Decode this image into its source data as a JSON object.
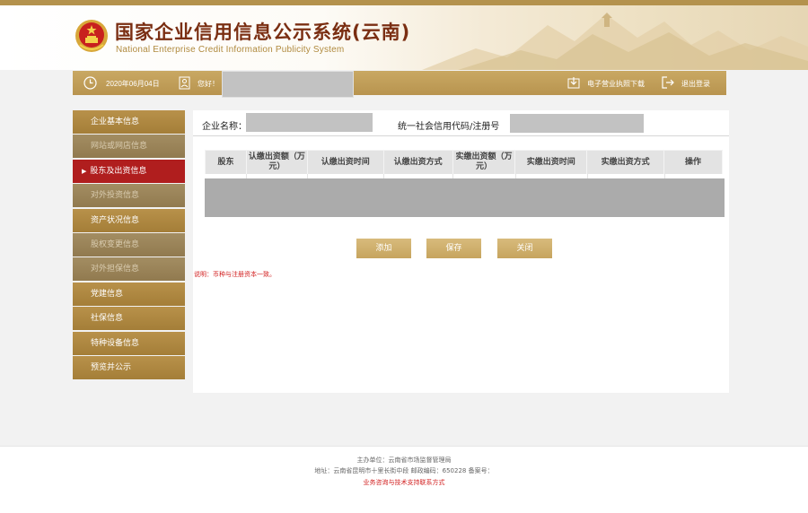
{
  "header": {
    "title": "国家企业信用信息公示系统(云南)",
    "subtitle": "National Enterprise Credit Information Publicity System"
  },
  "userbar": {
    "date": "2020年06月04日",
    "greeting": "您好！",
    "download_label": "电子营业执照下载",
    "logout_label": "退出登录"
  },
  "sidebar": {
    "items": [
      {
        "label": "企业基本信息",
        "state": "normal"
      },
      {
        "label": "网站或网店信息",
        "state": "dim"
      },
      {
        "label": "股东及出资信息",
        "state": "active"
      },
      {
        "label": "对外投资信息",
        "state": "dim"
      },
      {
        "label": "资产状况信息",
        "state": "normal"
      },
      {
        "label": "股权变更信息",
        "state": "dim"
      },
      {
        "label": "对外担保信息",
        "state": "dim"
      },
      {
        "label": "党建信息",
        "state": "normal"
      },
      {
        "label": "社保信息",
        "state": "normal"
      },
      {
        "label": "特种设备信息",
        "state": "normal"
      },
      {
        "label": "预览并公示",
        "state": "normal"
      }
    ]
  },
  "main": {
    "company_name_label": "企业名称：",
    "credit_code_label": "统一社会信用代码/注册号",
    "table": {
      "headers": [
        "股东",
        "认缴出资额（万元）",
        "认缴出资时间",
        "认缴出资方式",
        "实缴出资额（万元）",
        "实缴出资时间",
        "实缴出资方式",
        "操作"
      ]
    },
    "buttons": {
      "add": "添加",
      "save": "保存",
      "close": "关闭"
    },
    "note": "说明：币种与注册资本一致。"
  },
  "footer": {
    "sponsor": "主办单位：云南省市场监督管理局",
    "address": "地址：云南省昆明市十里长街中段  邮政编码：650228  备案号：",
    "contact_link": "业务咨询与技术支持联系方式"
  },
  "colors": {
    "gold": "#b8914a",
    "active_red": "#b01e1e",
    "title_red": "#7a2e12",
    "note_red": "#d21f1f"
  }
}
